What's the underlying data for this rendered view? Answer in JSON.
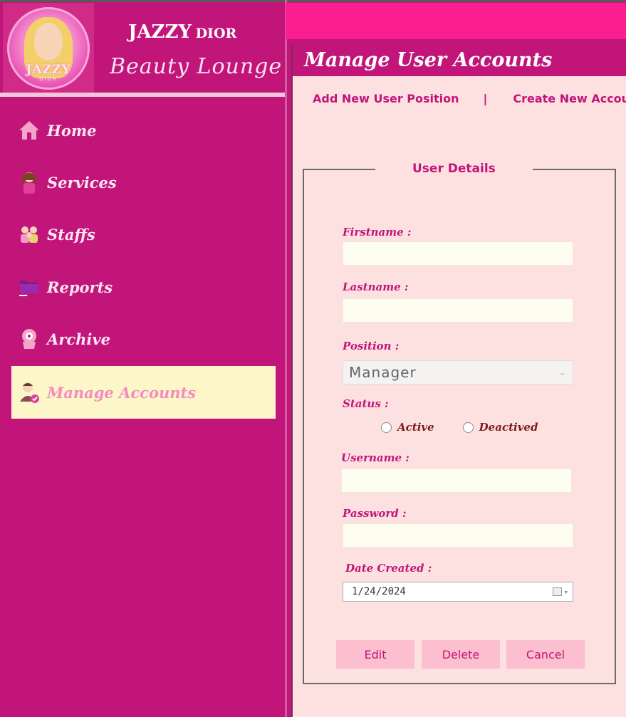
{
  "brand": {
    "logo_text": "JAZZY",
    "logo_sub": "DIOR",
    "title_main": "JAZZY",
    "title_suffix": "DIOR",
    "subtitle": "Beauty Lounge"
  },
  "sidebar": {
    "items": [
      {
        "label": "Home",
        "icon": "home-icon"
      },
      {
        "label": "Services",
        "icon": "stylist-icon"
      },
      {
        "label": "Staffs",
        "icon": "staff-group-icon"
      },
      {
        "label": "Reports",
        "icon": "folder-icon"
      },
      {
        "label": "Archive",
        "icon": "archive-person-icon"
      },
      {
        "label": "Manage Accounts",
        "icon": "user-check-icon",
        "active": true
      }
    ]
  },
  "panel": {
    "title": "Manage User Accounts",
    "link_add_position": "Add New User Position",
    "link_separator": "|",
    "link_create_account": "Create New Accou"
  },
  "form": {
    "section_title": "User Details",
    "firstname_label": "Firstname :",
    "firstname_value": "",
    "lastname_label": "Lastname :",
    "lastname_value": "",
    "position_label": "Position :",
    "position_value": "Manager",
    "status_label": "Status :",
    "status_options": [
      "Active",
      "Deactived"
    ],
    "username_label": "Username :",
    "username_value": "",
    "password_label": "Password :",
    "password_value": "",
    "date_label": "Date Created :",
    "date_value": "1/24/2024"
  },
  "buttons": {
    "edit": "Edit",
    "delete": "Delete",
    "cancel": "Cancel"
  },
  "colors": {
    "sidebar": "#c2157a",
    "topbar": "#fb1e90",
    "panel_bg": "#fde0e0",
    "active_item": "#fdf6c8",
    "input_bg": "#fefef0",
    "button_bg": "#fbbfd0"
  }
}
